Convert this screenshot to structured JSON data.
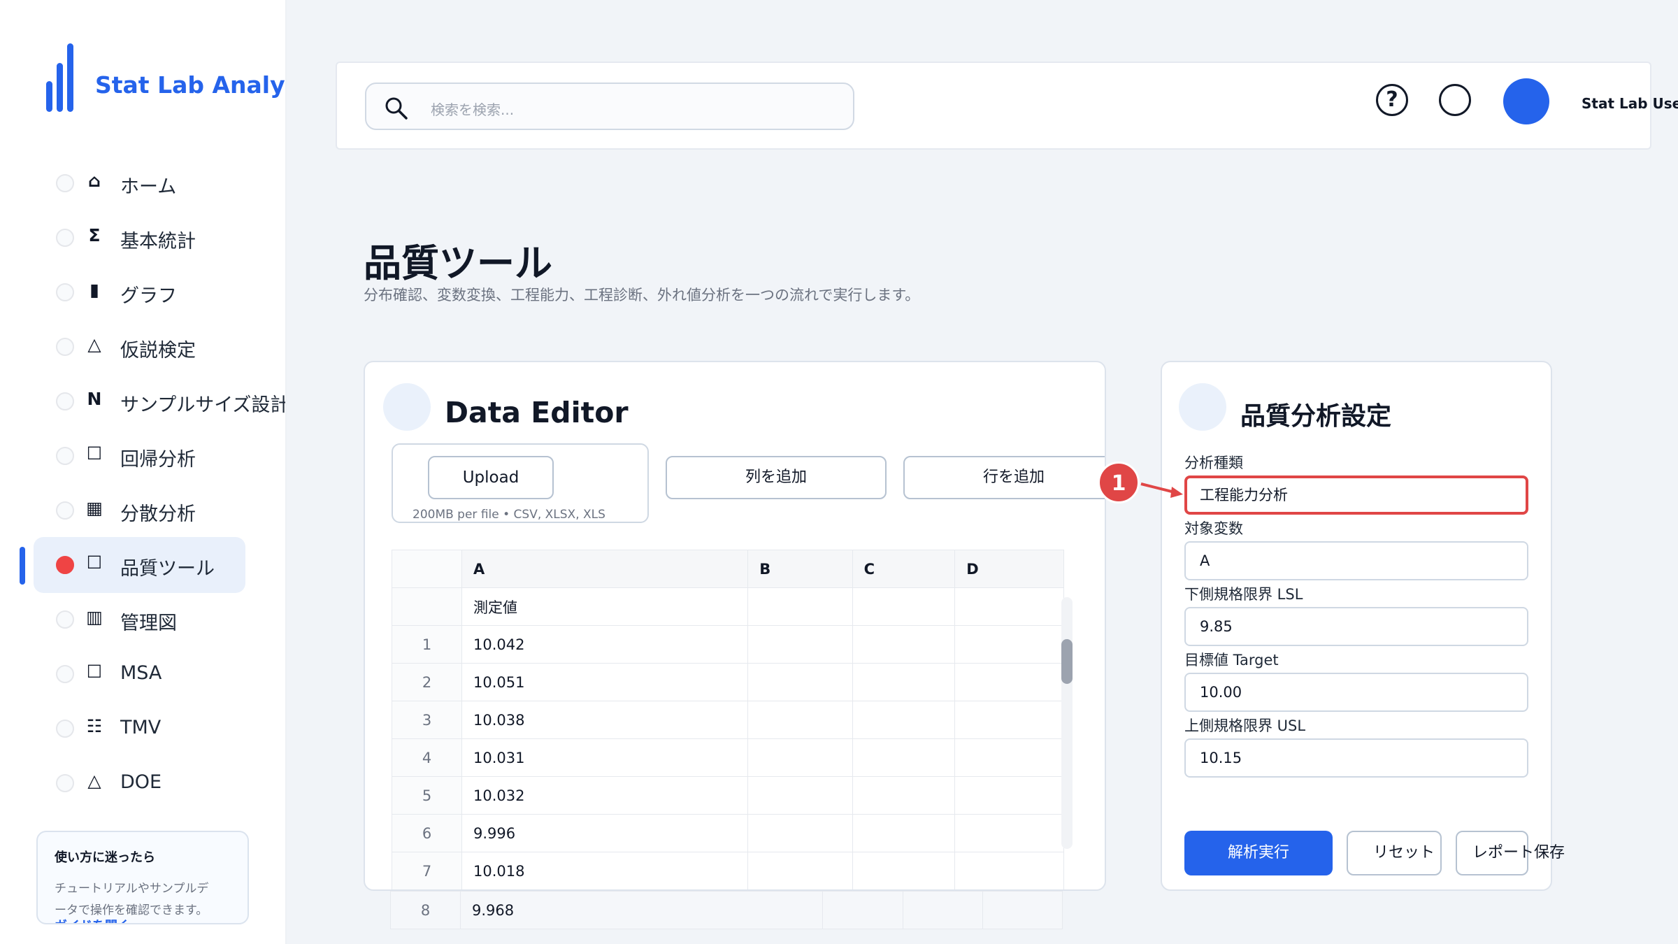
{
  "app": {
    "brand": "Stat Lab Analytics"
  },
  "sidebar": {
    "items": [
      {
        "icon": "⌂",
        "icon_name": "home-icon",
        "label": "ホーム"
      },
      {
        "icon": "Σ",
        "icon_name": "sigma-icon",
        "label": "基本統計"
      },
      {
        "icon": "▮",
        "icon_name": "bar-chart-icon",
        "label": "グラフ"
      },
      {
        "icon": "△",
        "icon_name": "triangle-icon",
        "label": "仮説検定"
      },
      {
        "icon": "N",
        "icon_name": "n-icon",
        "label": "サンプルサイズ設計"
      },
      {
        "icon": "☐",
        "icon_name": "square-icon",
        "label": "回帰分析"
      },
      {
        "icon": "▦",
        "icon_name": "grid-icon",
        "label": "分散分析"
      },
      {
        "icon": "☐",
        "icon_name": "square-icon",
        "label": "品質ツール",
        "active": true
      },
      {
        "icon": "▥",
        "icon_name": "control-chart-icon",
        "label": "管理図"
      },
      {
        "icon": "☐",
        "icon_name": "square-icon",
        "label": "MSA"
      },
      {
        "icon": "☷",
        "icon_name": "list-icon",
        "label": "TMV"
      },
      {
        "icon": "△",
        "icon_name": "triangle-icon",
        "label": "DOE"
      }
    ],
    "help": {
      "title": "使い方に迷ったら",
      "text": "チュートリアルやサンプルデータで操作を確認できます。",
      "link": "ガイドを開く"
    }
  },
  "header": {
    "search_placeholder": "検索を検索...",
    "help_icon": "?",
    "user_name": "Stat Lab User"
  },
  "page": {
    "title": "品質ツール",
    "subtitle": "分布確認、変数変換、工程能力、工程診断、外れ値分析を一つの流れで実行します。"
  },
  "editor": {
    "title": "Data Editor",
    "upload_label": "Upload",
    "upload_note": "200MB per file • CSV, XLSX, XLS",
    "add_column": "列を追加",
    "add_row": "行を追加",
    "columns": [
      "A",
      "B",
      "C",
      "D"
    ],
    "header_row": "測定値",
    "rows": [
      {
        "idx": "1",
        "a": "10.042"
      },
      {
        "idx": "2",
        "a": "10.051"
      },
      {
        "idx": "3",
        "a": "10.038"
      },
      {
        "idx": "4",
        "a": "10.031"
      },
      {
        "idx": "5",
        "a": "10.032"
      },
      {
        "idx": "6",
        "a": "9.996"
      },
      {
        "idx": "7",
        "a": "10.018"
      }
    ],
    "overflow_row": {
      "idx": "8",
      "a": "9.968"
    }
  },
  "settings": {
    "title": "品質分析設定",
    "analysis_type_label": "分析種類",
    "analysis_type_value": "工程能力分析",
    "target_var_label": "対象変数",
    "target_var_value": "A",
    "lsl_label": "下側規格限界 LSL",
    "lsl_value": "9.85",
    "target_label": "目標値 Target",
    "target_value": "10.00",
    "usl_label": "上側規格限界 USL",
    "usl_value": "10.15",
    "run_label": "解析実行",
    "reset_label": "リセット",
    "save_label": "レポート保存"
  },
  "annotation": {
    "marker": "1"
  },
  "colors": {
    "accent": "#2563eb",
    "marker": "#e04646"
  }
}
